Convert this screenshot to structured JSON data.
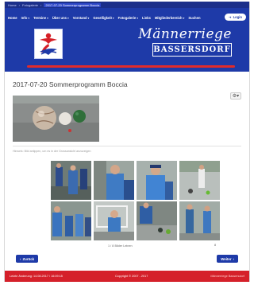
{
  "breadcrumb": {
    "items": [
      "Home",
      "Fotogalerie"
    ],
    "current": "2017-07-20 Sommerprogramm Boccia"
  },
  "nav": {
    "items": [
      {
        "label": "Home",
        "has_caret": false
      },
      {
        "label": "Info",
        "has_caret": true
      },
      {
        "label": "Termine",
        "has_caret": true
      },
      {
        "label": "Über uns",
        "has_caret": true
      },
      {
        "label": "Vorstand",
        "has_caret": true
      },
      {
        "label": "Geselligkeit",
        "has_caret": true
      },
      {
        "label": "Fotogalerie",
        "has_caret": true
      },
      {
        "label": "Links",
        "has_caret": false
      },
      {
        "label": "Mitgliederbereich",
        "has_caret": true
      },
      {
        "label": "Suchen",
        "has_caret": false
      }
    ],
    "login_label": "Login"
  },
  "brand": {
    "title": "Männerriege",
    "subtitle": "BASSERSDORF",
    "accent_color": "#1e3aa8",
    "line_color": "#e02b2b"
  },
  "article": {
    "title": "2017-07-20 Sommerprogramm Boccia",
    "gear_icon": "gear-icon",
    "caption": "Hinweis: Bild antippen, um es in der Grossansicht anzuzeigen"
  },
  "gallery": {
    "caption": "1 / 8 Bilder Leinen",
    "count": "8"
  },
  "pager": {
    "prev_label": "Zurück",
    "next_label": "Weiter"
  },
  "footer": {
    "left": "Letzte Änderung: 14.08.2017 / 16:09:15",
    "middle": "Copyright © 2007 - 2017",
    "right": "Männerriege Bassersdorf",
    "bg_color": "#d5202a"
  }
}
